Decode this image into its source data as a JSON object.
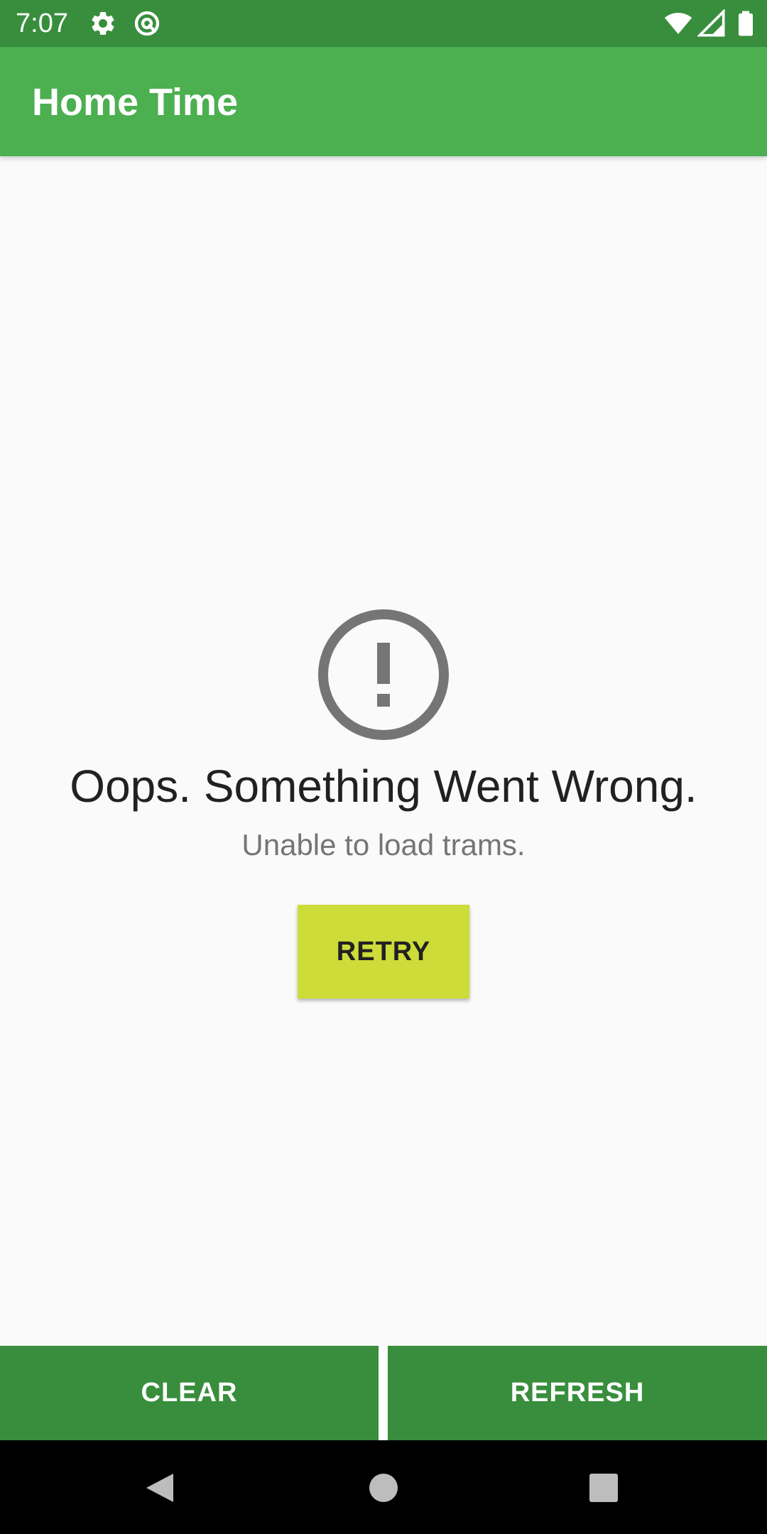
{
  "status_bar": {
    "time": "7:07",
    "icons": [
      "gear-icon",
      "at-icon",
      "wifi-icon",
      "signal-icon",
      "battery-icon"
    ]
  },
  "app_bar": {
    "title": "Home Time"
  },
  "error": {
    "icon": "exclamation-circle-icon",
    "title": "Oops. Something Went Wrong.",
    "message": "Unable to load trams.",
    "retry_label": "RETRY"
  },
  "bottom_actions": {
    "clear_label": "CLEAR",
    "refresh_label": "REFRESH"
  },
  "nav_bar": {
    "icons": [
      "back-icon",
      "home-icon",
      "recents-icon"
    ]
  },
  "colors": {
    "primary": "#4CAF50",
    "primary_dark": "#388E3C",
    "accent": "#CDDC39",
    "background": "#FAFAFA",
    "error_icon": "#757575"
  }
}
